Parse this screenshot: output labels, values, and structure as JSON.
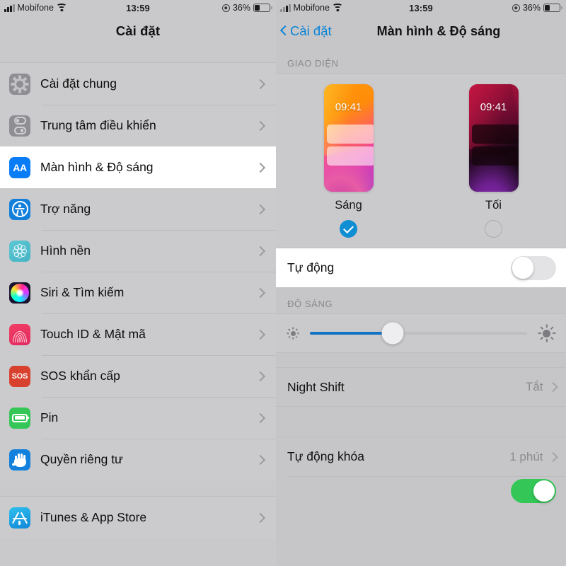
{
  "status_bar": {
    "carrier": "Mobifone",
    "time": "13:59",
    "battery_percent": "36%",
    "wifi_icon": "wifi-icon",
    "signal_icon": "signal-bars-icon",
    "location_icon": "location-icon",
    "battery_icon": "battery-icon"
  },
  "left_panel": {
    "nav_title": "Cài đặt",
    "groups": [
      {
        "items": [
          {
            "label": "Cài đặt chung",
            "icon": "gear-icon",
            "selected": false
          },
          {
            "label": "Trung tâm điều khiển",
            "icon": "sliders-icon",
            "selected": false
          },
          {
            "label": "Màn hình & Độ sáng",
            "icon": "display-aa-icon",
            "selected": true
          },
          {
            "label": "Trợ năng",
            "icon": "accessibility-icon",
            "selected": false
          },
          {
            "label": "Hình nền",
            "icon": "wallpaper-icon",
            "selected": false
          },
          {
            "label": "Siri & Tìm kiếm",
            "icon": "siri-icon",
            "selected": false
          },
          {
            "label": "Touch ID & Mật mã",
            "icon": "fingerprint-icon",
            "selected": false
          },
          {
            "label": "SOS khẩn cấp",
            "icon": "sos-icon",
            "selected": false
          },
          {
            "label": "Pin",
            "icon": "battery-app-icon",
            "selected": false
          },
          {
            "label": "Quyền riêng tư",
            "icon": "hand-icon",
            "selected": false
          }
        ]
      },
      {
        "items": [
          {
            "label": "iTunes & App Store",
            "icon": "app-store-icon",
            "selected": false
          }
        ]
      }
    ]
  },
  "right_panel": {
    "back_label": "Cài đặt",
    "nav_title": "Màn hình & Độ sáng",
    "appearance": {
      "section_header": "GIAO DIỆN",
      "options": [
        {
          "label": "Sáng",
          "preview_time": "09:41",
          "selected": true,
          "theme": "light"
        },
        {
          "label": "Tối",
          "preview_time": "09:41",
          "selected": false,
          "theme": "dark"
        }
      ],
      "auto_row": {
        "label": "Tự động",
        "toggle_on": false
      }
    },
    "brightness": {
      "section_header": "ĐỘ SÁNG",
      "value_percent": 38,
      "low_icon": "sun-small-icon",
      "high_icon": "sun-large-icon"
    },
    "rows": [
      {
        "label": "Night Shift",
        "value": "Tắt"
      },
      {
        "label": "Tự động khóa",
        "value": "1 phút"
      }
    ],
    "bottom_toggle_on": true
  },
  "colors": {
    "accent_blue": "#0a7cf6",
    "link_blue": "#0a84d8",
    "slider_blue": "#1272c4",
    "toggle_green": "#34c758",
    "panel_bg": "#c6c6c8",
    "row_bg": "#cbcbcd"
  }
}
